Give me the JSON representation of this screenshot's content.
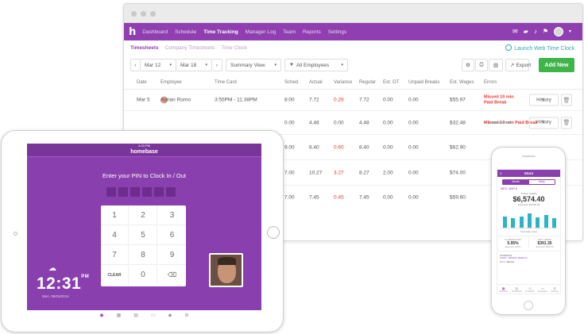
{
  "browser": {
    "app": {
      "logo": "h",
      "nav": [
        "Dashboard",
        "Schedule",
        "Time Tracking",
        "Manager Log",
        "Team",
        "Reports",
        "Settings"
      ],
      "active_nav": "Time Tracking"
    },
    "subnav": {
      "tabs": [
        "Timesheets",
        "Company Timesheets",
        "Time Clock"
      ],
      "launch": "Launch Web Time Clock"
    },
    "toolbar": {
      "prev": "‹",
      "start_date": "Mar 12",
      "end_date": "Mar 18",
      "next": "›",
      "view": "Summary View",
      "filter": "All Employees",
      "export": "Export",
      "add": "Add New"
    },
    "table": {
      "headers": [
        "Date",
        "Employee",
        "Time Card",
        "Sched.",
        "Actual",
        "Variance",
        "Regular",
        "Est. OT",
        "Unpaid Breaks",
        "Est. Wages",
        "Errors"
      ],
      "history_label": "History",
      "rows": [
        {
          "date": "Mar 5",
          "employee": "Adrian Romo",
          "time_card": "3:55PM - 11:38PM",
          "sched": "8:00",
          "actual": "7.72",
          "variance": "0.28",
          "regular": "7.72",
          "est_ot": "0.00",
          "unpaid": "0.00",
          "wages": "$55.97",
          "error": "Missed 10 min Paid Break",
          "more": ""
        },
        {
          "date": "",
          "employee": "",
          "time_card": "",
          "sched": "0.00",
          "actual": "4.48",
          "variance": "0.00",
          "regular": "4.48",
          "est_ot": "0.00",
          "unpaid": "0.00",
          "wages": "$32.48",
          "error": "Missed 10 min Paid Break",
          "more": "+ 1 more error"
        },
        {
          "date": "",
          "employee": "",
          "time_card": "",
          "sched": "9.00",
          "actual": "8.40",
          "variance": "0.60",
          "regular": "8.40",
          "est_ot": "0.00",
          "unpaid": "0.00",
          "wages": "$62.90",
          "error": "",
          "more": ""
        },
        {
          "date": "",
          "employee": "",
          "time_card": "",
          "sched": "7.00",
          "actual": "10.27",
          "variance": "3.27",
          "regular": "8.27",
          "est_ot": "2.00",
          "unpaid": "0.00",
          "wages": "$74.00",
          "error": "",
          "more": ""
        },
        {
          "date": "",
          "employee": "",
          "time_card": "",
          "sched": "7.00",
          "actual": "7.45",
          "variance": "0.45",
          "regular": "7.45",
          "est_ot": "0.00",
          "unpaid": "0.00",
          "wages": "$59.60",
          "error": "",
          "more": ""
        }
      ]
    }
  },
  "tablet": {
    "status_time": "4:20 PM",
    "app_title": "homebase",
    "prompt": "Enter your PIN to Clock In / Out",
    "keys": [
      "1",
      "2",
      "3",
      "4",
      "5",
      "6",
      "7",
      "8",
      "9",
      "CLEAR",
      "0",
      "⌫"
    ],
    "clock": "12:31",
    "clock_suffix": "PM",
    "date": "Mon, 09/15/2014"
  },
  "phone": {
    "title": "Store",
    "tabs": [
      "Month",
      "Daily"
    ],
    "week": "WED, MAR 8",
    "total_label": "TOTAL SALES",
    "total": "$6,574.40",
    "total_sub": "Expected: $5,893.00",
    "bars": [
      0.55,
      0.45,
      0.55,
      0.7,
      0.5,
      0.6,
      0.45
    ],
    "legend": "Total Sales    Labor",
    "stats": [
      {
        "label": "% LABOR COST",
        "value": "5.95%",
        "sub": "Expected: 9.00%"
      },
      {
        "label": "EST. LABOR",
        "value": "$391.35",
        "sub": "Expected: $530.00"
      }
    ],
    "schedule_label": "SCHEDULE",
    "schedule_row": "TODAY • MONDAY MARCH 6",
    "shift": "Fri 3 - Barista",
    "nav": [
      "Schedule",
      "Timesheets",
      "Timeclock",
      "Messages",
      "Settings"
    ]
  },
  "colors": {
    "brand": "#8f3fb0",
    "accent": "#3fb549",
    "link": "#2fa7b3",
    "error": "#e8352f"
  }
}
